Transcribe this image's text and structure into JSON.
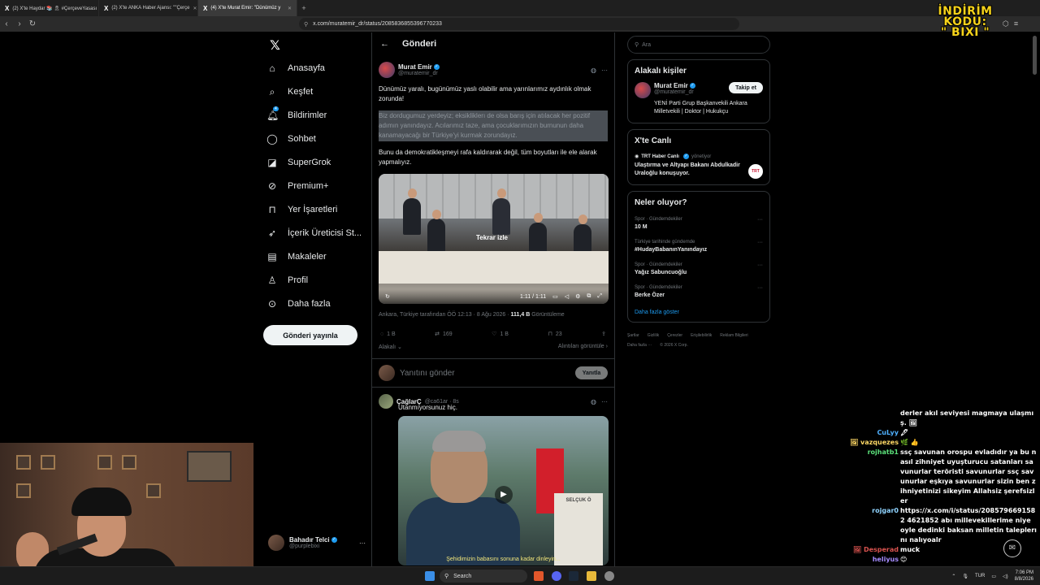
{
  "browser": {
    "tabs": [
      {
        "title": "(2) X'te Haydar 📚 🎗 #ÇerçeveYasası",
        "active": false
      },
      {
        "title": "(2) X'te ANKA Haber Ajansı: \"\"Çerçe",
        "active": false
      },
      {
        "title": "(4) X'te Murat Emir: \"Dünümüz y",
        "active": true
      }
    ],
    "url": "x.com/muratemir_dr/status/2085836855396770233",
    "promo_line1": "İNDİRİM KODU:",
    "promo_line2": "\" BIXI \""
  },
  "xnav": {
    "logo": "𝕏",
    "items": [
      {
        "label": "Anasayfa",
        "icon": "home-icon",
        "glyph": "⌂"
      },
      {
        "label": "Keşfet",
        "icon": "search-icon",
        "glyph": "⌕"
      },
      {
        "label": "Bildirimler",
        "icon": "bell-icon",
        "glyph": "🔔︎",
        "badge": "4"
      },
      {
        "label": "Sohbet",
        "icon": "chat-icon",
        "glyph": "◯"
      },
      {
        "label": "SuperGrok",
        "icon": "grok-icon",
        "glyph": "◪"
      },
      {
        "label": "Premium+",
        "icon": "premium-icon",
        "glyph": "⊘"
      },
      {
        "label": "Yer İşaretleri",
        "icon": "bookmark-icon",
        "glyph": "⊓"
      },
      {
        "label": "İçerik Üreticisi St...",
        "icon": "rocket-icon",
        "glyph": "➶"
      },
      {
        "label": "Makaleler",
        "icon": "article-icon",
        "glyph": "▤"
      },
      {
        "label": "Profil",
        "icon": "profile-icon",
        "glyph": "♙"
      },
      {
        "label": "Daha fazla",
        "icon": "more-icon",
        "glyph": "⊙"
      }
    ],
    "post_button": "Gönderi yayınla",
    "account": {
      "name": "Bahadır Telci",
      "handle": "@purplebixi"
    }
  },
  "post": {
    "header": "Gönderi",
    "author_name": "Murat Emir",
    "author_handle": "@muratemir_dr",
    "para1": "Dünümüz yaralı, bugünümüz yaslı olabilir ama yarınlarımız aydınlık olmak zorunda!",
    "para2": "Biz dordugumuz yerdeyiz; eksikliklerı de olsa barış için atılacak her pozitif adımın yanındayız. Acılarımız taze, ama çocuklarımızın burnunun daha kanamayacağı bir Türkiye'yi kurmak zorundayız.",
    "para3": "Bunu da demokratikleşmeyi rafa kaldırarak değil, tüm boyutları ile ele alarak yapmalıyız.",
    "video_replay": "Tekrar izle",
    "video_time": "1:11 / 1:11",
    "meta_location": "Ankara, Türkiye tarafından ÖÖ 12:13 · 8 Ağu 2026 · ",
    "meta_views_count": "111,4 B",
    "meta_views_label": " Görüntüleme",
    "replies": "1 B",
    "reposts": "169",
    "likes": "1 B",
    "bookmarks": "23",
    "related": "Alakalı",
    "view_quotes": "Alıntıları görüntüle",
    "reply_placeholder": "Yanıtını gönder",
    "reply_button": "Yanıtla"
  },
  "reply": {
    "name": "ÇağlarÇ",
    "handle": "@ca61ar · 8s",
    "text": "Utanmıyorsunuz hiç.",
    "stone_text": "SELÇUK Ö",
    "caption": "Şehidimizin babasını sonuna kadar dinleyin..."
  },
  "right": {
    "search_placeholder": "Ara",
    "related_people_title": "Alakalı kişiler",
    "person_name": "Murat Emir",
    "person_handle": "@muratemir_dr",
    "follow": "Takip et",
    "person_bio": "YENİ Parti Grup Başkanvekili Ankara Milletvekili | Doktor | Hukukçu",
    "live_title": "X'te Canlı",
    "live_source": "TRT Haber Canlı",
    "live_state": "yönetiyor",
    "live_text": "Ulaştırma ve Altyapı Bakanı Abdulkadir Uraloğlu konuşuyor.",
    "trt_logo": "TRT",
    "trends_title": "Neler oluyor?",
    "trends": [
      {
        "context": "Spor · Gündemdekiler",
        "title": "10 M"
      },
      {
        "context": "Türkiye tarihinde gündemde",
        "title": "#HudayBabanınYanındayız"
      },
      {
        "context": "Spor · Gündemdekiler",
        "title": "Yağız Sabuncuoğlu"
      },
      {
        "context": "Spor · Gündemdekiler",
        "title": "Berke Özer"
      }
    ],
    "show_more": "Daha fazla göster",
    "footer": [
      "Şartlar",
      "Gizlilik",
      "Çerezler",
      "Erişilebilirlik",
      "Reklam Bilgileri",
      "Daha fazla ···",
      "© 2026 X Corp."
    ]
  },
  "chat": [
    {
      "user": "",
      "msg": "derler akıl seviyesi magmaya ulaşmış. 🖼",
      "color": "#ffffff"
    },
    {
      "user": "CuLyy",
      "msg": "🖋",
      "color": "#4fb0ff"
    },
    {
      "user": "🖼 vazquezes",
      "msg": "🌿 👍",
      "color": "#ffd966"
    },
    {
      "user": "rojhatb1",
      "msg": "ssç savunan orospu evladıdır ya bu nasıl zihniyet uyuşturucu satanları savunurlar teröristi savunurlar ssç savunurlar eşkıya savunurlar sizin ben zihniyetinizi sikeyim Allahsiz şerefsizler",
      "color": "#5be07a"
    },
    {
      "user": "rojgar0",
      "msg": "https://x.com/i/status/2085796691582 4621852 abı millevekillerime niye oyle dedinki baksan milletin taleplerını nalıyoalr",
      "color": "#8fd3ff"
    },
    {
      "user": "🖼 Desperad",
      "msg": "muck",
      "color": "#d9534f"
    },
    {
      "user": "heliyus",
      "msg": "😊",
      "color": "#a58bff"
    }
  ],
  "taskbar": {
    "search": "Search",
    "lang": "TUR",
    "time": "7:06 PM",
    "date": "8/8/2026"
  }
}
